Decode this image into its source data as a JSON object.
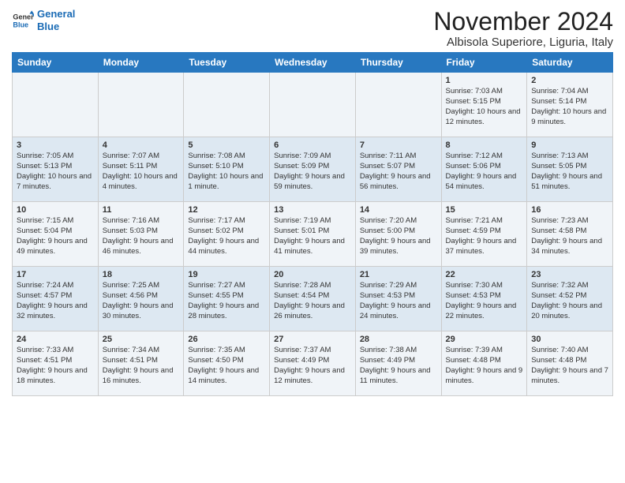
{
  "header": {
    "logo_general": "General",
    "logo_blue": "Blue",
    "month": "November 2024",
    "location": "Albisola Superiore, Liguria, Italy"
  },
  "days_of_week": [
    "Sunday",
    "Monday",
    "Tuesday",
    "Wednesday",
    "Thursday",
    "Friday",
    "Saturday"
  ],
  "weeks": [
    [
      {
        "day": "",
        "info": ""
      },
      {
        "day": "",
        "info": ""
      },
      {
        "day": "",
        "info": ""
      },
      {
        "day": "",
        "info": ""
      },
      {
        "day": "",
        "info": ""
      },
      {
        "day": "1",
        "info": "Sunrise: 7:03 AM\nSunset: 5:15 PM\nDaylight: 10 hours and 12 minutes."
      },
      {
        "day": "2",
        "info": "Sunrise: 7:04 AM\nSunset: 5:14 PM\nDaylight: 10 hours and 9 minutes."
      }
    ],
    [
      {
        "day": "3",
        "info": "Sunrise: 7:05 AM\nSunset: 5:13 PM\nDaylight: 10 hours and 7 minutes."
      },
      {
        "day": "4",
        "info": "Sunrise: 7:07 AM\nSunset: 5:11 PM\nDaylight: 10 hours and 4 minutes."
      },
      {
        "day": "5",
        "info": "Sunrise: 7:08 AM\nSunset: 5:10 PM\nDaylight: 10 hours and 1 minute."
      },
      {
        "day": "6",
        "info": "Sunrise: 7:09 AM\nSunset: 5:09 PM\nDaylight: 9 hours and 59 minutes."
      },
      {
        "day": "7",
        "info": "Sunrise: 7:11 AM\nSunset: 5:07 PM\nDaylight: 9 hours and 56 minutes."
      },
      {
        "day": "8",
        "info": "Sunrise: 7:12 AM\nSunset: 5:06 PM\nDaylight: 9 hours and 54 minutes."
      },
      {
        "day": "9",
        "info": "Sunrise: 7:13 AM\nSunset: 5:05 PM\nDaylight: 9 hours and 51 minutes."
      }
    ],
    [
      {
        "day": "10",
        "info": "Sunrise: 7:15 AM\nSunset: 5:04 PM\nDaylight: 9 hours and 49 minutes."
      },
      {
        "day": "11",
        "info": "Sunrise: 7:16 AM\nSunset: 5:03 PM\nDaylight: 9 hours and 46 minutes."
      },
      {
        "day": "12",
        "info": "Sunrise: 7:17 AM\nSunset: 5:02 PM\nDaylight: 9 hours and 44 minutes."
      },
      {
        "day": "13",
        "info": "Sunrise: 7:19 AM\nSunset: 5:01 PM\nDaylight: 9 hours and 41 minutes."
      },
      {
        "day": "14",
        "info": "Sunrise: 7:20 AM\nSunset: 5:00 PM\nDaylight: 9 hours and 39 minutes."
      },
      {
        "day": "15",
        "info": "Sunrise: 7:21 AM\nSunset: 4:59 PM\nDaylight: 9 hours and 37 minutes."
      },
      {
        "day": "16",
        "info": "Sunrise: 7:23 AM\nSunset: 4:58 PM\nDaylight: 9 hours and 34 minutes."
      }
    ],
    [
      {
        "day": "17",
        "info": "Sunrise: 7:24 AM\nSunset: 4:57 PM\nDaylight: 9 hours and 32 minutes."
      },
      {
        "day": "18",
        "info": "Sunrise: 7:25 AM\nSunset: 4:56 PM\nDaylight: 9 hours and 30 minutes."
      },
      {
        "day": "19",
        "info": "Sunrise: 7:27 AM\nSunset: 4:55 PM\nDaylight: 9 hours and 28 minutes."
      },
      {
        "day": "20",
        "info": "Sunrise: 7:28 AM\nSunset: 4:54 PM\nDaylight: 9 hours and 26 minutes."
      },
      {
        "day": "21",
        "info": "Sunrise: 7:29 AM\nSunset: 4:53 PM\nDaylight: 9 hours and 24 minutes."
      },
      {
        "day": "22",
        "info": "Sunrise: 7:30 AM\nSunset: 4:53 PM\nDaylight: 9 hours and 22 minutes."
      },
      {
        "day": "23",
        "info": "Sunrise: 7:32 AM\nSunset: 4:52 PM\nDaylight: 9 hours and 20 minutes."
      }
    ],
    [
      {
        "day": "24",
        "info": "Sunrise: 7:33 AM\nSunset: 4:51 PM\nDaylight: 9 hours and 18 minutes."
      },
      {
        "day": "25",
        "info": "Sunrise: 7:34 AM\nSunset: 4:51 PM\nDaylight: 9 hours and 16 minutes."
      },
      {
        "day": "26",
        "info": "Sunrise: 7:35 AM\nSunset: 4:50 PM\nDaylight: 9 hours and 14 minutes."
      },
      {
        "day": "27",
        "info": "Sunrise: 7:37 AM\nSunset: 4:49 PM\nDaylight: 9 hours and 12 minutes."
      },
      {
        "day": "28",
        "info": "Sunrise: 7:38 AM\nSunset: 4:49 PM\nDaylight: 9 hours and 11 minutes."
      },
      {
        "day": "29",
        "info": "Sunrise: 7:39 AM\nSunset: 4:48 PM\nDaylight: 9 hours and 9 minutes."
      },
      {
        "day": "30",
        "info": "Sunrise: 7:40 AM\nSunset: 4:48 PM\nDaylight: 9 hours and 7 minutes."
      }
    ]
  ]
}
